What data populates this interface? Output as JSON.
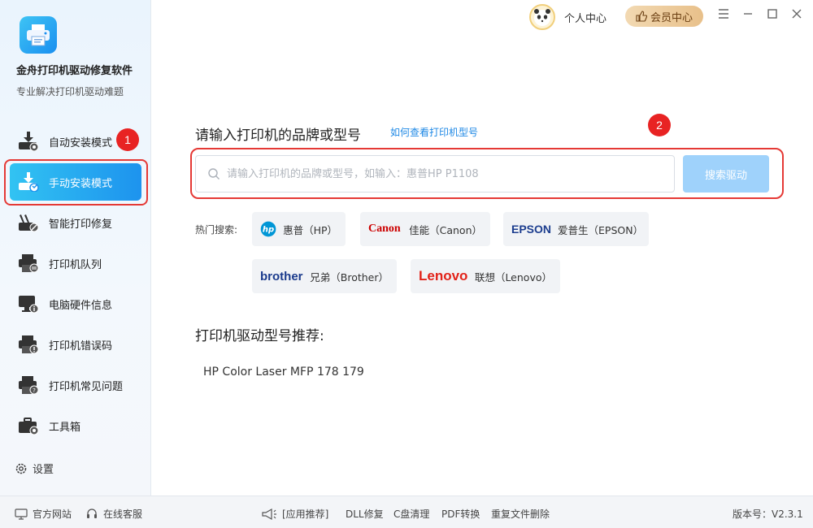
{
  "app": {
    "title": "金舟打印机驱动修复软件",
    "subtitle": "专业解决打印机驱动难题"
  },
  "sidebar": {
    "items": [
      {
        "label": "自动安装模式",
        "icon": "download-printer-icon"
      },
      {
        "label": "手动安装模式",
        "icon": "download-hand-icon"
      },
      {
        "label": "智能打印修复",
        "icon": "wrench-repair-icon"
      },
      {
        "label": "打印机队列",
        "icon": "printer-queue-icon"
      },
      {
        "label": "电脑硬件信息",
        "icon": "monitor-icon"
      },
      {
        "label": "打印机错误码",
        "icon": "printer-error-icon"
      },
      {
        "label": "打印机常见问题",
        "icon": "printer-question-icon"
      },
      {
        "label": "工具箱",
        "icon": "toolbox-icon"
      }
    ],
    "settings_label": "设置",
    "active_index": 1
  },
  "badges": {
    "one": "1",
    "two": "2"
  },
  "topbar": {
    "personal_label": "个人中心",
    "vip_label": "会员中心"
  },
  "main": {
    "query_title": "请输入打印机的品牌或型号",
    "query_link": "如何查看打印机型号",
    "search_placeholder": "请输入打印机的品牌或型号，如输入：惠普HP P1108",
    "search_button": "搜索驱动",
    "hot_label": "热门搜索:",
    "brands": [
      {
        "logo": "hp",
        "label": "惠普（HP）",
        "color": "#0096d6"
      },
      {
        "logo": "Canon",
        "label": "佳能（Canon）",
        "color": "#cc0000"
      },
      {
        "logo": "EPSON",
        "label": "爱普生（EPSON）",
        "color": "#1d3e8f"
      },
      {
        "logo": "brother",
        "label": "兄弟（Brother）",
        "color": "#1a3a8c"
      },
      {
        "logo": "Lenovo",
        "label": "联想（Lenovo）",
        "color": "#e2231a"
      }
    ],
    "rec_title": "打印机驱动型号推荐:",
    "rec_items": [
      "HP Color Laser MFP 178 179"
    ]
  },
  "footer": {
    "site": "官方网站",
    "service": "在线客服",
    "app_rec": "[应用推荐]",
    "dll": "DLL修复",
    "cdisk": "C盘清理",
    "pdf": "PDF转换",
    "dup": "重复文件删除",
    "version": "版本号：V2.3.1"
  }
}
